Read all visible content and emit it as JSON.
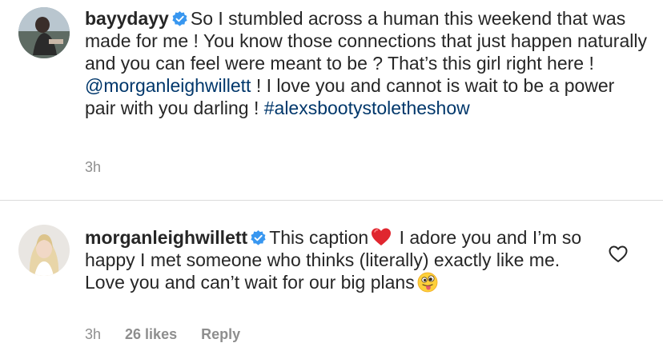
{
  "comments": [
    {
      "username": "bayydayy",
      "verified": true,
      "segments": {
        "text_1": "So I stumbled across a human this weekend that was made for me ! You know those connections that just happen naturally and you can feel were meant to be ? That’s this girl right here ! ",
        "mention": "@morganleighwillett",
        "text_2": " ! I love you and cannot is wait to be a power pair with you darling ! ",
        "hashtag": "#alexsbootystoletheshow"
      },
      "time": "3h"
    },
    {
      "username": "morganleighwillett",
      "verified": true,
      "segments": {
        "text_1": "This caption",
        "emoji_1": "red-heart",
        "text_2": " I adore you and I’m so happy I met someone who thinks (literally) exactly like me. Love you and can’t wait for our big plans",
        "emoji_2": "winking-tongue-face"
      },
      "time": "3h",
      "likes": "26 likes",
      "reply": "Reply"
    }
  ],
  "colors": {
    "text": "#262626",
    "link": "#00376b",
    "muted": "#8e8e8e",
    "verified": "#3897f0",
    "divider": "#dbdbdb"
  }
}
